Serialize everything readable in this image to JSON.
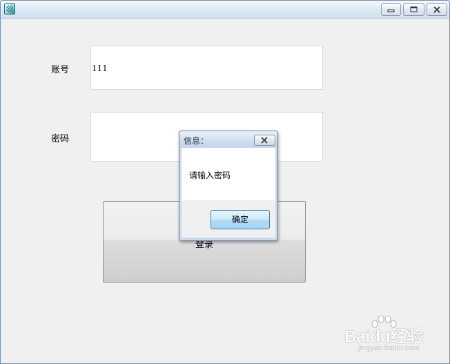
{
  "window": {
    "app_icon": "app-icon",
    "controls": {
      "minimize_icon": "minimize-icon",
      "maximize_icon": "maximize-icon",
      "close_icon": "close-icon"
    }
  },
  "form": {
    "account_label": "账号",
    "account_value": "111",
    "password_label": "密码",
    "password_value": "",
    "login_button": "登录"
  },
  "dialog": {
    "title": "信息：",
    "message": "请输入密码",
    "ok_button": "确定",
    "close_icon": "close-icon"
  },
  "watermark": {
    "logo_text": "Baidu经验",
    "url": "jingyan.baidu.com"
  }
}
